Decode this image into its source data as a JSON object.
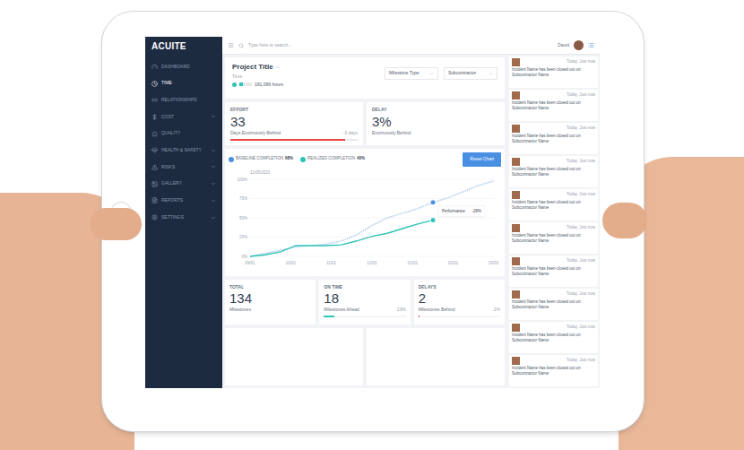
{
  "app": {
    "logo": "ACUITE"
  },
  "sidebar": {
    "items": [
      {
        "label": "DASHBOARD",
        "selected": false,
        "expandable": false
      },
      {
        "label": "TIME",
        "selected": true,
        "expandable": false
      },
      {
        "label": "RELATIONSHIPS",
        "selected": false,
        "expandable": false
      },
      {
        "label": "COST",
        "selected": false,
        "expandable": true
      },
      {
        "label": "QUALITY",
        "selected": false,
        "expandable": false
      },
      {
        "label": "HEALTH & SAFETY",
        "selected": false,
        "expandable": true
      },
      {
        "label": "RISKS",
        "selected": false,
        "expandable": true
      },
      {
        "label": "GALLERY",
        "selected": false,
        "expandable": true
      },
      {
        "label": "REPORTS",
        "selected": false,
        "expandable": true
      },
      {
        "label": "SETTINGS",
        "selected": false,
        "expandable": true
      }
    ]
  },
  "topbar": {
    "search_placeholder": "Type here to search...",
    "user": "David"
  },
  "project": {
    "title": "Project Title",
    "subtitle": "Time",
    "hours": "191,096 hours",
    "level": 0.3
  },
  "filters": [
    "Milestone Type",
    "Subcontractor"
  ],
  "kpis": [
    {
      "label": "EFFORT",
      "value": "33",
      "caption": "Days Enormously Behind",
      "delta": "-3 days",
      "level": 0.9,
      "color": "#ef4444"
    },
    {
      "label": "DELAY",
      "value": "3%",
      "caption": "Enormously Behind"
    }
  ],
  "chart": {
    "date": "11/05/2015",
    "legend": [
      {
        "label": "BASELINE COMPLETION",
        "value": "68%",
        "color": "#4a90e2"
      },
      {
        "label": "REALIZED COMPLETION",
        "value": "40%",
        "color": "#2ec4b6"
      }
    ],
    "reset_button": "Reset Chart",
    "y_ticks": [
      "100%",
      "75%",
      "50%",
      "25%",
      "0%"
    ],
    "x_ticks": [
      "09/01",
      "10/01",
      "11/01",
      "12/01",
      "01/01",
      "02/01",
      "03/01"
    ],
    "series": [
      {
        "name": "baseline",
        "color": "#a9c8ee",
        "values": [
          0,
          4,
          8,
          12,
          14,
          16,
          20,
          28,
          40,
          50,
          56,
          62,
          70,
          76,
          84,
          92,
          98
        ]
      },
      {
        "name": "realized",
        "color": "#2ec4b6",
        "values": [
          0,
          2,
          6,
          14,
          14,
          14,
          15,
          20,
          26,
          30,
          36,
          42,
          47
        ]
      }
    ],
    "tooltip": {
      "label": "Performance",
      "value": "-28%"
    }
  },
  "milestones": [
    {
      "label": "TOTAL",
      "value": "134",
      "caption": "Milestones"
    },
    {
      "label": "ON TIME",
      "value": "18",
      "caption": "Milestones Ahead",
      "percent": "13%",
      "level": 0.13,
      "color": "#2ec4b6"
    },
    {
      "label": "DELAYS",
      "value": "2",
      "caption": "Milestones Behind",
      "percent": "2%",
      "level": 0.02,
      "color": "#ef4444"
    }
  ],
  "feed": [
    {
      "time": "Today, Just now",
      "text": "Incident Name has been closed out on Subcontractor Name"
    },
    {
      "time": "Today, Just now",
      "text": "Incident Name has been closed out on Subcontractor Name"
    },
    {
      "time": "Today, Just now",
      "text": "Incident Name has been closed out on Subcontractor Name"
    },
    {
      "time": "Today, Just now",
      "text": "Incident Name has been closed out on Subcontractor Name"
    },
    {
      "time": "Today, Just now",
      "text": "Incident Name has been closed out on Subcontractor Name"
    },
    {
      "time": "Today, Just now",
      "text": "Incident Name has been closed out on Subcontractor Name"
    },
    {
      "time": "Today, Just now",
      "text": "Incident Name has been closed out on Subcontractor Name"
    },
    {
      "time": "Today, Just now",
      "text": "Incident Name has been closed out on Subcontractor Name"
    },
    {
      "time": "Today, Just now",
      "text": "Incident Name has been closed out on Subcontractor Name"
    },
    {
      "time": "Today, Just now",
      "text": "Incident Name has been closed out on Subcontractor Name"
    }
  ]
}
